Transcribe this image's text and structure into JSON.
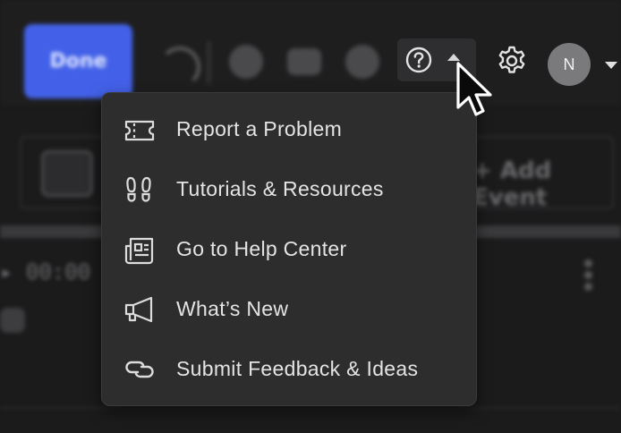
{
  "header": {
    "done_label": "Done",
    "avatar_initial": "N"
  },
  "toolbar": {
    "add_event_label": "+ Add Event",
    "time_readout": "▸ 00:00"
  },
  "help_menu": {
    "items": [
      {
        "label": "Report a Problem",
        "icon": "ticket-icon"
      },
      {
        "label": "Tutorials & Resources",
        "icon": "footprints-icon"
      },
      {
        "label": "Go to Help Center",
        "icon": "newspaper-icon"
      },
      {
        "label": "What’s New",
        "icon": "megaphone-icon"
      },
      {
        "label": "Submit Feedback & Ideas",
        "icon": "link-icon"
      }
    ]
  },
  "colors": {
    "background": "#1b1b1c",
    "menu_background": "#2d2d2e",
    "accent": "#4361e8",
    "text": "#e4e4e4"
  }
}
